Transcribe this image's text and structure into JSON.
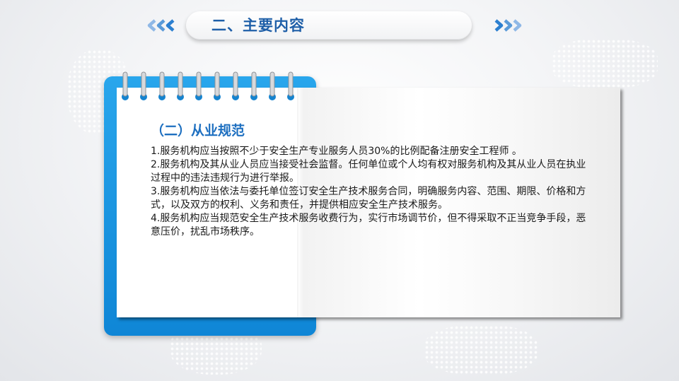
{
  "header": {
    "title": "二、主要内容"
  },
  "section": {
    "title": "（二）从业规范",
    "items": [
      "1.服务机构应当按照不少于安全生产专业服务人员30%的比例配备注册安全工程师 。",
      "2.服务机构及其从业人员应当接受社会监督。任何单位或个人均有权对服务机构及其从业人员在执业过程中的违法违规行为进行举报。",
      "3.服务机构应当依法与委托单位签订安全生产技术服务合同，明确服务内容、范围、期限、价格和方式，以及双方的权利、义务和责任，并提供相应安全生产技术服务。",
      "4.服务机构应当规范安全生产技术服务收费行为，实行市场调节价，但不得采取不正当竞争手段，恶意压价，扰乱市场秩序。"
    ]
  },
  "colors": {
    "accent_blue": "#1f5fa8",
    "card_blue": "#1a95e0",
    "chevron_blue": "#2b7fd0"
  },
  "icons": {
    "left_decoration": "chevrons-left-icon",
    "right_decoration": "chevrons-right-icon",
    "binding": "spiral-ring-icon"
  }
}
